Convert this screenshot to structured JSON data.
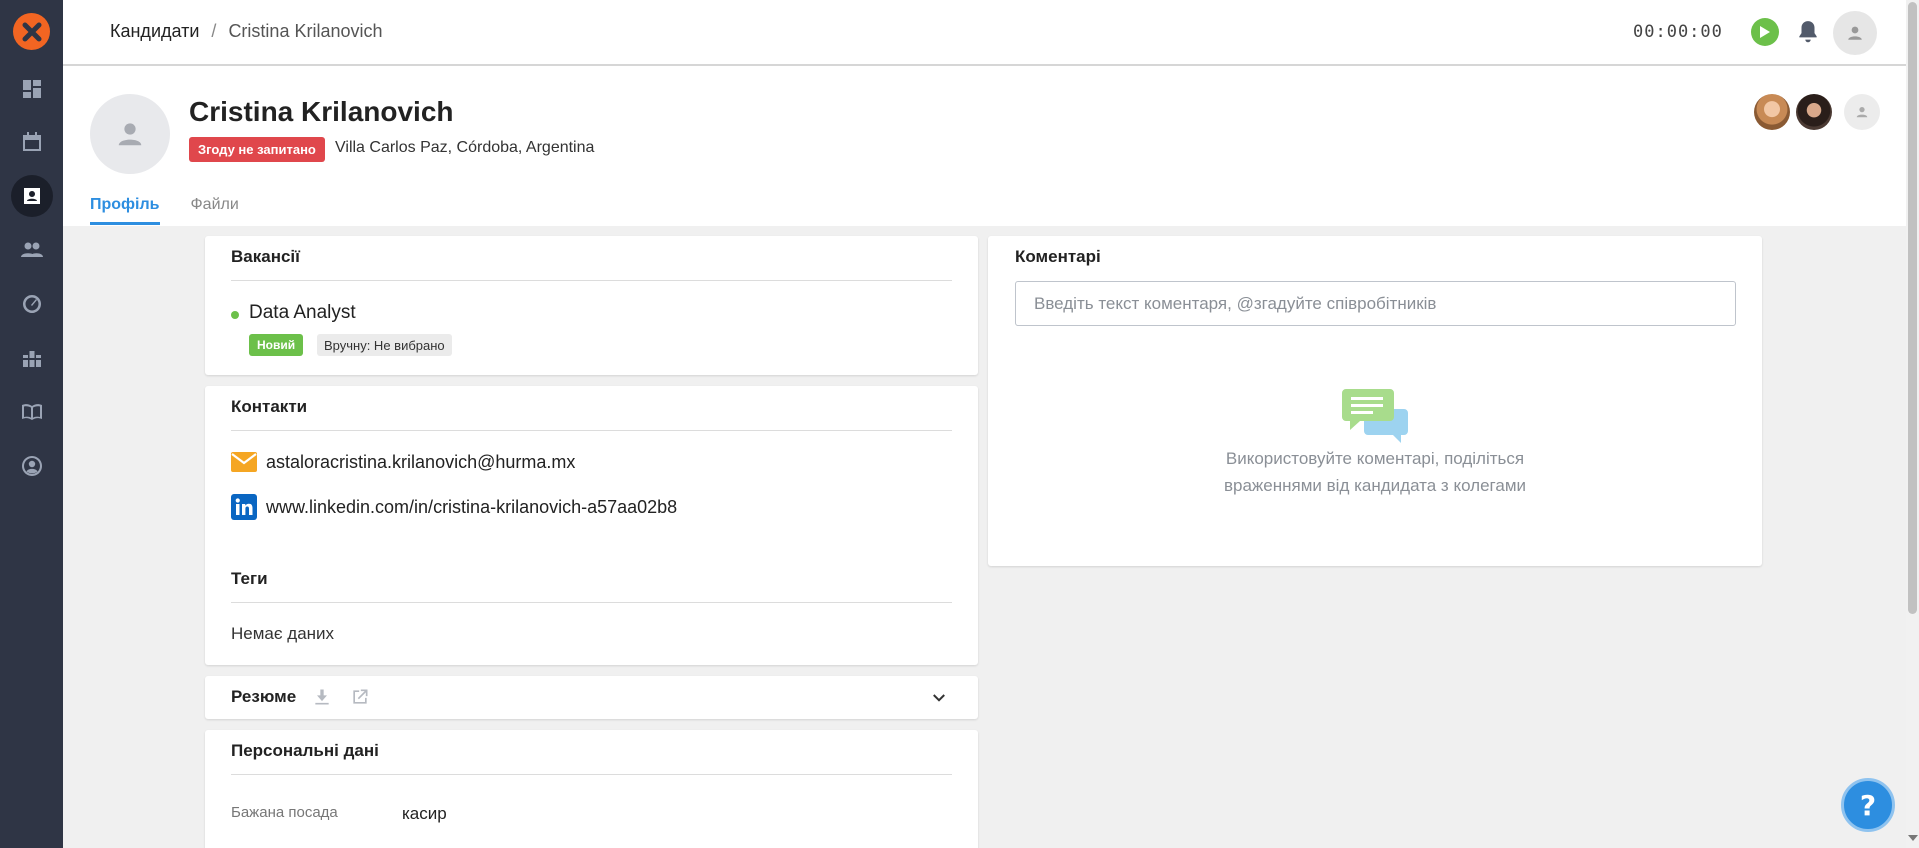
{
  "breadcrumb": {
    "root": "Кандидати",
    "separator": "/",
    "current": "Cristina Krilanovich"
  },
  "timer": "00:00:00",
  "candidate": {
    "name": "Cristina Krilanovich",
    "consent_badge": "Згоду не запитано",
    "location": "Villa Carlos Paz, Córdoba, Argentina"
  },
  "tabs": [
    {
      "label": "Профіль",
      "active": true
    },
    {
      "label": "Файли",
      "active": false
    }
  ],
  "vacancies": {
    "title": "Вакансії",
    "items": [
      {
        "name": "Data Analyst",
        "stage": "Новий",
        "source": "Вручну: Не вибрано"
      }
    ]
  },
  "contacts": {
    "title": "Контакти",
    "email": "astaloracristina.krilanovich@hurma.mx",
    "linkedin": "www.linkedin.com/in/cristina-krilanovich-a57aa02b8"
  },
  "tags": {
    "title": "Теги",
    "empty": "Немає даних"
  },
  "resume": {
    "title": "Резюме"
  },
  "personal": {
    "title": "Персональні дані",
    "fields": [
      {
        "label": "Бажана посада",
        "value": "касир"
      }
    ]
  },
  "comments": {
    "title": "Коментарі",
    "placeholder": "Введіть текст коментаря, @згадуйте співробітників",
    "empty_line1": "Використовуйте коментарі, поділіться",
    "empty_line2": "враженнями від кандидата з колегами"
  },
  "help": {
    "label": "?"
  },
  "colors": {
    "sidebar": "#2f3545",
    "logo": "#f26522",
    "accent": "#2d8ee0",
    "danger": "#e0474c",
    "success": "#6cc04a"
  },
  "icons": {
    "sidebar": [
      "dashboard-icon",
      "calendar-icon",
      "candidates-icon",
      "team-icon",
      "gauge-icon",
      "blocks-icon",
      "book-icon",
      "user-circle-icon"
    ],
    "topbar": [
      "play-icon",
      "bell-icon",
      "user-icon"
    ],
    "contacts": [
      "mail-icon",
      "linkedin-icon"
    ],
    "resume": [
      "download-icon",
      "external-link-icon",
      "chevron-down-icon"
    ]
  }
}
